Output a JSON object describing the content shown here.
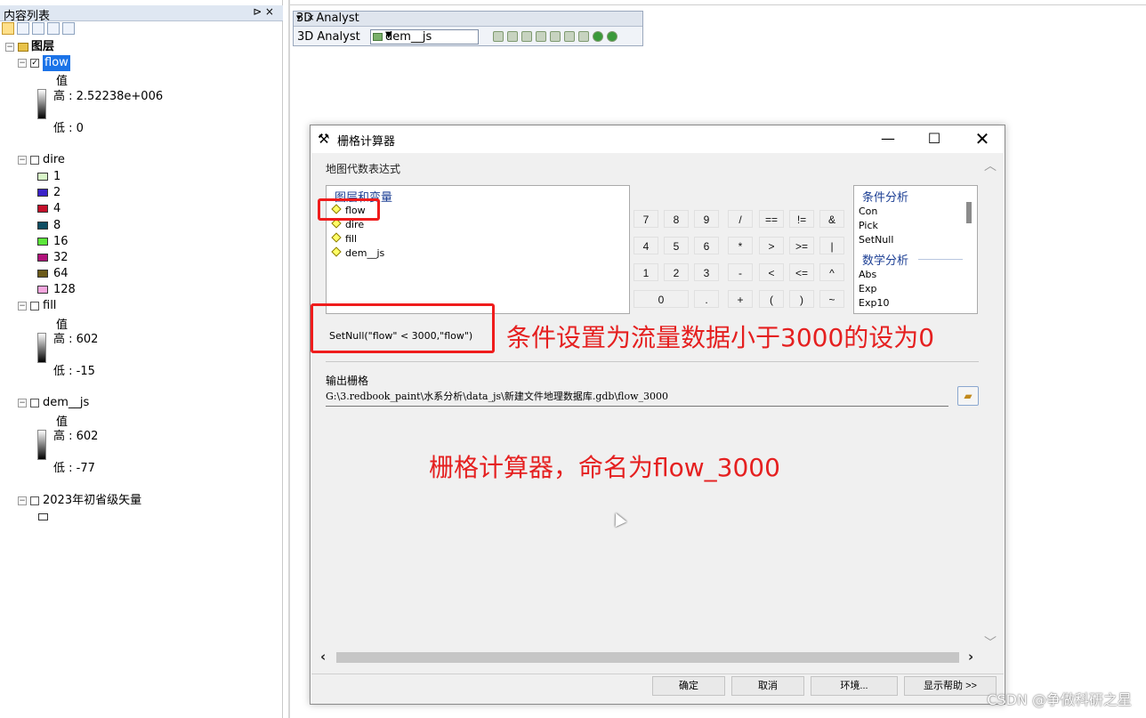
{
  "toc": {
    "title": "内容列表",
    "pin": "⊳ ×",
    "root_label": "图层",
    "layers": [
      {
        "name": "flow",
        "checked": true,
        "value_label": "值",
        "high": "高 : 2.52238e+006",
        "low": "低 : 0"
      },
      {
        "name": "dire",
        "checked": false,
        "classes": [
          {
            "label": "1",
            "color": "#d8f5c8"
          },
          {
            "label": "2",
            "color": "#3a22c8"
          },
          {
            "label": "4",
            "color": "#c4102a"
          },
          {
            "label": "8",
            "color": "#0f4e63"
          },
          {
            "label": "16",
            "color": "#5ce63a"
          },
          {
            "label": "32",
            "color": "#b0127a"
          },
          {
            "label": "64",
            "color": "#6b5a1a"
          },
          {
            "label": "128",
            "color": "#f4a6de"
          }
        ]
      },
      {
        "name": "fill",
        "checked": false,
        "value_label": "值",
        "high": "高 : 602",
        "low": "低 : -15"
      },
      {
        "name": "dem__js",
        "checked": false,
        "value_label": "值",
        "high": "高 : 602",
        "low": "低 : -77"
      },
      {
        "name": "2023年初省级矢量",
        "checked": false
      }
    ]
  },
  "toolbar3d": {
    "title": "3D Analyst",
    "menu_label": "3D Analyst",
    "layer_combo": "dem__js"
  },
  "dialog": {
    "title": "栅格计算器",
    "expr_section": "地图代数表达式",
    "vars_header": "图层和变量",
    "variables": [
      "flow",
      "dire",
      "fill",
      "dem__js"
    ],
    "keys": [
      [
        "7",
        "8",
        "9",
        "/",
        "==",
        "!=",
        "&"
      ],
      [
        "4",
        "5",
        "6",
        "*",
        ">",
        ">=",
        "|"
      ],
      [
        "1",
        "2",
        "3",
        "-",
        "<",
        "<=",
        "^"
      ],
      [
        "0",
        ".",
        "+",
        "(",
        ")",
        "~"
      ]
    ],
    "func_groups": [
      {
        "name": "条件分析",
        "items": [
          "Con",
          "Pick",
          "SetNull"
        ]
      },
      {
        "name": "数学分析",
        "items": [
          "Abs",
          "Exp",
          "Exp10"
        ]
      }
    ],
    "expression": "SetNull(\"flow\" < 3000,\"flow\")",
    "output_label": "输出栅格",
    "output_path": "G:\\3.redbook_paint\\水系分析\\data_js\\新建文件地理数据库.gdb\\flow_3000",
    "buttons": {
      "ok": "确定",
      "cancel": "取消",
      "env": "环境...",
      "help": "显示帮助 >>"
    }
  },
  "annotations": {
    "condition_note": "条件设置为流量数据小于3000的设为0",
    "naming_note": "栅格计算器，命名为flow_3000",
    "color": "#e52020"
  },
  "watermark": "CSDN @争做科研之星"
}
